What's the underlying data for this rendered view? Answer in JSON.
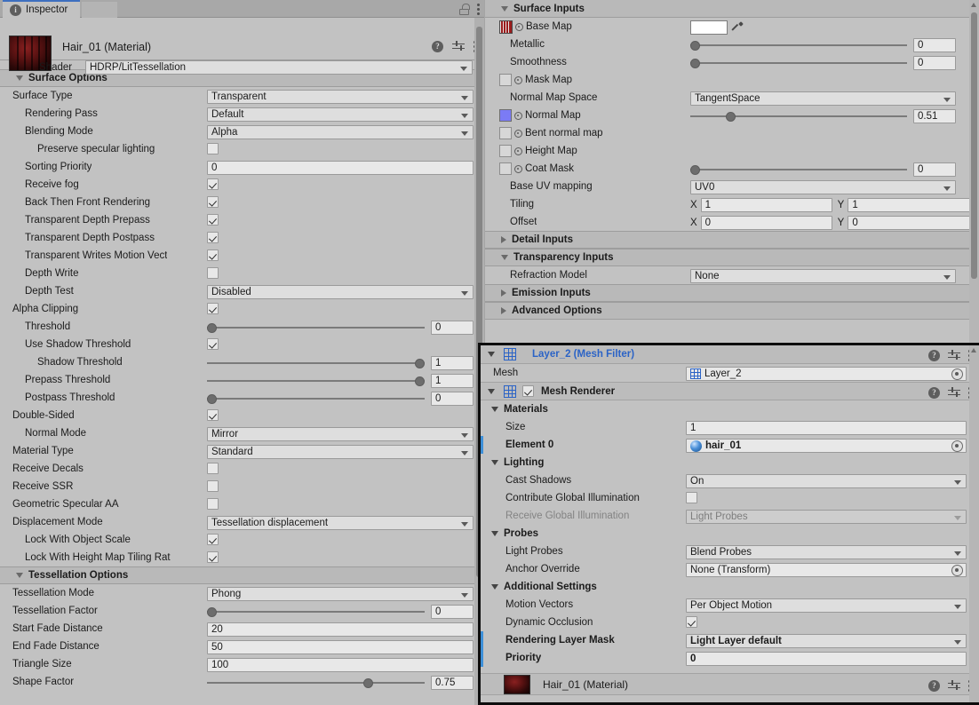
{
  "window": {
    "tab_label": "Inspector",
    "tab_icon": "info-icon",
    "lock_icon": "lock-open-icon",
    "menu_icon": "kebab-menu-icon"
  },
  "material_header": {
    "title": "Hair_01 (Material)",
    "shader_label": "Shader",
    "shader_value": "HDRP/LitTessellation",
    "thumbnail_name": "material-preview-sphere"
  },
  "surface_options": {
    "title": "Surface Options",
    "rows": [
      {
        "label": "Surface Type",
        "indent": 0,
        "type": "dropdown",
        "value": "Transparent"
      },
      {
        "label": "Rendering Pass",
        "indent": 1,
        "type": "dropdown",
        "value": "Default"
      },
      {
        "label": "Blending Mode",
        "indent": 1,
        "type": "dropdown",
        "value": "Alpha"
      },
      {
        "label": "Preserve specular lighting",
        "indent": 2,
        "type": "checkbox",
        "checked": false
      },
      {
        "label": "Sorting Priority",
        "indent": 1,
        "type": "field",
        "value": "0"
      },
      {
        "label": "Receive fog",
        "indent": 1,
        "type": "checkbox",
        "checked": true
      },
      {
        "label": "Back Then Front Rendering",
        "indent": 1,
        "type": "checkbox",
        "checked": true
      },
      {
        "label": "Transparent Depth Prepass",
        "indent": 1,
        "type": "checkbox",
        "checked": true
      },
      {
        "label": "Transparent Depth Postpass",
        "indent": 1,
        "type": "checkbox",
        "checked": true
      },
      {
        "label": "Transparent Writes Motion Vect",
        "indent": 1,
        "type": "checkbox",
        "checked": true
      },
      {
        "label": "Depth Write",
        "indent": 1,
        "type": "checkbox",
        "checked": false
      },
      {
        "label": "Depth Test",
        "indent": 1,
        "type": "dropdown",
        "value": "Disabled"
      },
      {
        "label": "Alpha Clipping",
        "indent": 0,
        "type": "checkbox",
        "checked": true
      },
      {
        "label": "Threshold",
        "indent": 1,
        "type": "slider",
        "value": "0",
        "pos": 0
      },
      {
        "label": "Use Shadow Threshold",
        "indent": 1,
        "type": "checkbox",
        "checked": true
      },
      {
        "label": "Shadow Threshold",
        "indent": 2,
        "type": "slider",
        "value": "1",
        "pos": 100
      },
      {
        "label": "Prepass Threshold",
        "indent": 1,
        "type": "slider",
        "value": "1",
        "pos": 100
      },
      {
        "label": "Postpass Threshold",
        "indent": 1,
        "type": "slider",
        "value": "0",
        "pos": 0
      },
      {
        "label": "Double-Sided",
        "indent": 0,
        "type": "checkbox",
        "checked": true
      },
      {
        "label": "Normal Mode",
        "indent": 1,
        "type": "dropdown",
        "value": "Mirror"
      },
      {
        "label": "Material Type",
        "indent": 0,
        "type": "dropdown",
        "value": "Standard"
      },
      {
        "label": "Receive Decals",
        "indent": 0,
        "type": "checkbox",
        "checked": false
      },
      {
        "label": "Receive SSR",
        "indent": 0,
        "type": "checkbox",
        "checked": false
      },
      {
        "label": "Geometric Specular AA",
        "indent": 0,
        "type": "checkbox",
        "checked": false
      },
      {
        "label": "Displacement Mode",
        "indent": 0,
        "type": "dropdown",
        "value": "Tessellation displacement"
      },
      {
        "label": "Lock With Object Scale",
        "indent": 1,
        "type": "checkbox",
        "checked": true
      },
      {
        "label": "Lock With Height Map Tiling Rat",
        "indent": 1,
        "type": "checkbox",
        "checked": true
      }
    ]
  },
  "tessellation_options": {
    "title": "Tessellation Options",
    "rows": [
      {
        "label": "Tessellation Mode",
        "indent": 0,
        "type": "dropdown",
        "value": "Phong"
      },
      {
        "label": "Tessellation Factor",
        "indent": 0,
        "type": "slider",
        "value": "0",
        "pos": 0
      },
      {
        "label": "Start Fade Distance",
        "indent": 0,
        "type": "field",
        "value": "20"
      },
      {
        "label": "End Fade Distance",
        "indent": 0,
        "type": "field",
        "value": "50"
      },
      {
        "label": "Triangle Size",
        "indent": 0,
        "type": "field",
        "value": "100"
      },
      {
        "label": "Shape Factor",
        "indent": 0,
        "type": "slider",
        "value": "0.75",
        "pos": 75
      }
    ]
  },
  "surface_inputs": {
    "title": "Surface Inputs",
    "rows": [
      {
        "label": "Base Map",
        "indent": 1,
        "type": "texture-color",
        "thumb": "basemap",
        "color": "#ffffff",
        "eyedropper": true
      },
      {
        "label": "Metallic",
        "indent": 1,
        "type": "slider",
        "value": "0",
        "pos": 0
      },
      {
        "label": "Smoothness",
        "indent": 1,
        "type": "slider",
        "value": "0",
        "pos": 0
      },
      {
        "label": "Mask Map",
        "indent": 1,
        "type": "texture",
        "thumb": "empty"
      },
      {
        "label": "Normal Map Space",
        "indent": 1,
        "type": "dropdown",
        "value": "TangentSpace"
      },
      {
        "label": "Normal Map",
        "indent": 1,
        "type": "texture-slider",
        "thumb": "#7b7bf5",
        "value": "0.51",
        "pos": 17
      },
      {
        "label": "Bent normal map",
        "indent": 1,
        "type": "texture",
        "thumb": "empty"
      },
      {
        "label": "Height Map",
        "indent": 1,
        "type": "texture",
        "thumb": "empty"
      },
      {
        "label": "Coat Mask",
        "indent": 1,
        "type": "texture-slider",
        "thumb": "empty",
        "value": "0",
        "pos": 0
      },
      {
        "label": "Base UV mapping",
        "indent": 1,
        "type": "dropdown",
        "value": "UV0"
      },
      {
        "label": "Tiling",
        "indent": 1,
        "type": "vector2",
        "x_label": "X",
        "x": "1",
        "y_label": "Y",
        "y": "1"
      },
      {
        "label": "Offset",
        "indent": 1,
        "type": "vector2",
        "x_label": "X",
        "x": "0",
        "y_label": "Y",
        "y": "0"
      }
    ]
  },
  "detail_inputs": {
    "title": "Detail Inputs",
    "expanded": false
  },
  "transparency_inputs": {
    "title": "Transparency Inputs",
    "expanded": true,
    "rows": [
      {
        "label": "Refraction Model",
        "indent": 1,
        "type": "dropdown",
        "value": "None"
      }
    ]
  },
  "emission_inputs": {
    "title": "Emission Inputs",
    "expanded": false
  },
  "advanced_options": {
    "title": "Advanced Options",
    "expanded": false
  },
  "mesh_filter": {
    "component_title": "Layer_2 (Mesh Filter)",
    "icon": "mesh-filter-icon",
    "rows": [
      {
        "label": "Mesh",
        "indent": 0,
        "type": "object",
        "value": "Layer_2",
        "icon": "mesh-icon"
      }
    ]
  },
  "mesh_renderer": {
    "component_title": "Mesh Renderer",
    "icon": "mesh-renderer-icon",
    "enabled": true,
    "groups": [
      {
        "title": "Materials",
        "rows": [
          {
            "label": "Size",
            "indent": 1,
            "type": "field",
            "value": "1"
          },
          {
            "label": "Element 0",
            "indent": 1,
            "type": "object",
            "value": "hair_01",
            "icon": "material-icon",
            "bold": true,
            "modified": true
          }
        ]
      },
      {
        "title": "Lighting",
        "rows": [
          {
            "label": "Cast Shadows",
            "indent": 1,
            "type": "dropdown",
            "value": "On"
          },
          {
            "label": "Contribute Global Illumination",
            "indent": 1,
            "type": "checkbox",
            "checked": false
          },
          {
            "label": "Receive Global Illumination",
            "indent": 1,
            "type": "dropdown",
            "value": "Light Probes",
            "disabled": true
          }
        ]
      },
      {
        "title": "Probes",
        "rows": [
          {
            "label": "Light Probes",
            "indent": 1,
            "type": "dropdown",
            "value": "Blend Probes"
          },
          {
            "label": "Anchor Override",
            "indent": 1,
            "type": "object",
            "value": "None (Transform)"
          }
        ]
      },
      {
        "title": "Additional Settings",
        "rows": [
          {
            "label": "Motion Vectors",
            "indent": 1,
            "type": "dropdown",
            "value": "Per Object Motion"
          },
          {
            "label": "Dynamic Occlusion",
            "indent": 1,
            "type": "checkbox",
            "checked": true
          },
          {
            "label": "Rendering Layer Mask",
            "indent": 1,
            "type": "dropdown",
            "value": "Light Layer default",
            "bold": true,
            "modified": true
          },
          {
            "label": "Priority",
            "indent": 1,
            "type": "field",
            "value": "0",
            "bold": true,
            "modified": true
          }
        ]
      }
    ]
  },
  "bottom_material": {
    "title": "Hair_01 (Material)",
    "thumbnail_name": "material-preview-sphere"
  },
  "colors": {
    "panel_bg": "#c2c2c2",
    "section_bg": "#b9b9b9",
    "field_bg": "#e8e8e8",
    "dropdown_bg": "#dedede",
    "accent_blue": "#2b63c6",
    "modified_bar": "#3d8fd8",
    "tab_accent": "#3d6fbf",
    "focus_border": "#0d0d0d"
  }
}
